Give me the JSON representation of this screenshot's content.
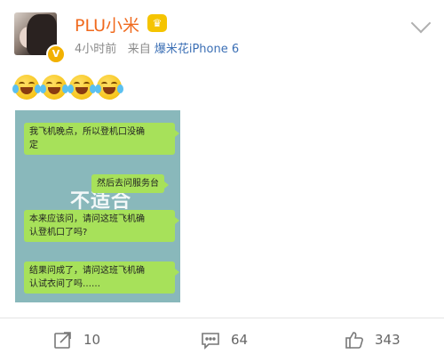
{
  "post": {
    "username": "PLU小米",
    "time": "4小时前",
    "source_prefix": "来自",
    "source_name": "爆米花iPhone 6",
    "badge": "V",
    "emoji_count": 4
  },
  "image": {
    "watermark": "不适合",
    "messages": [
      "我飞机晚点，所以登机口没确",
      "定",
      "然后去问服务台",
      "本来应该问，请问这班飞机确",
      "认登机口了吗?",
      "结果问成了，请问这班飞机确",
      "认试衣间了吗……"
    ]
  },
  "actions": {
    "repost_count": "10",
    "comment_count": "64",
    "like_count": "343"
  },
  "icons": {
    "repost": "share-icon",
    "comment": "comment-icon",
    "like": "thumbs-up-icon",
    "menu": "chevron-down-icon"
  },
  "colors": {
    "username": "#f06a1e",
    "source_link": "#3b6fb5",
    "bubble": "#a7e15a",
    "photo_bg": "#89b8bb"
  }
}
